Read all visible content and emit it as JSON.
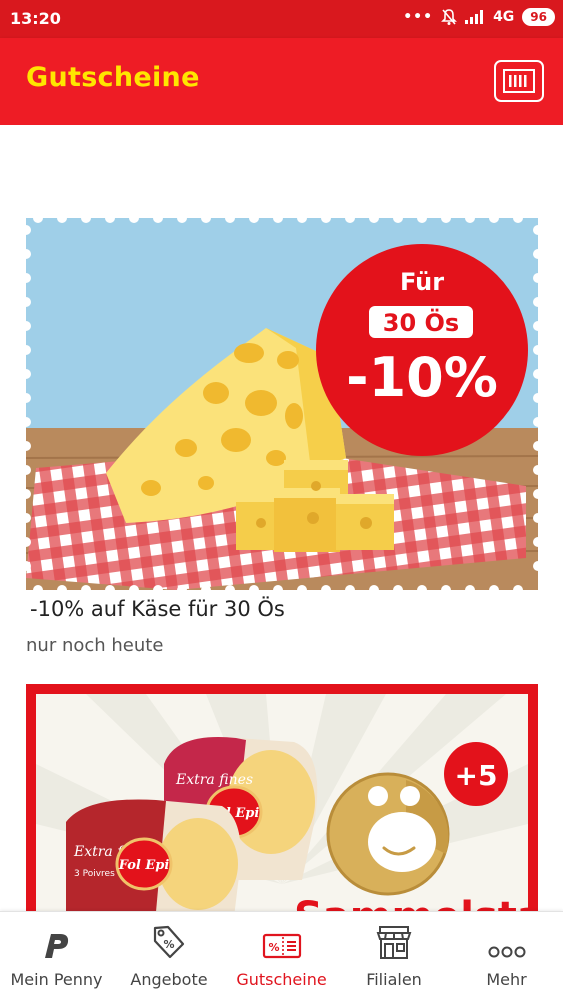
{
  "status_bar": {
    "time": "13:20",
    "network": "4G",
    "battery": "96"
  },
  "app_bar": {
    "title": "Gutscheine"
  },
  "coupons": [
    {
      "badge_line1": "Für",
      "badge_line2": "30 Ös",
      "badge_value": "-10%",
      "title": "-10% auf Käse für 30 Ös",
      "subtitle": "nur noch heute"
    },
    {
      "product_text_1": "Extra fines",
      "product_text_2": "3 Poivres",
      "brand_1": "Fol Epi",
      "badge_value": "+5",
      "banner_text": "Sammelstar"
    }
  ],
  "bottom_nav": [
    {
      "label": "Mein Penny",
      "icon": "penny-logo-icon",
      "active": false
    },
    {
      "label": "Angebote",
      "icon": "price-tag-icon",
      "active": false
    },
    {
      "label": "Gutscheine",
      "icon": "coupon-icon",
      "active": true
    },
    {
      "label": "Filialen",
      "icon": "store-icon",
      "active": false
    },
    {
      "label": "Mehr",
      "icon": "more-dots-icon",
      "active": false
    }
  ],
  "colors": {
    "brand_red": "#ee1c25",
    "status_red": "#d9181e",
    "title_yellow": "#ffe600",
    "active_nav": "#e0141e"
  }
}
